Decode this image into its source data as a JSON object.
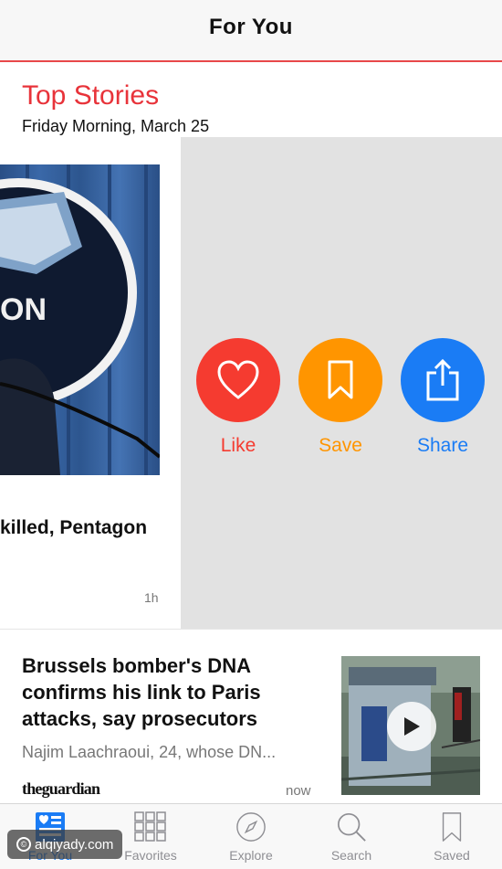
{
  "navbar": {
    "title": "For You"
  },
  "section": {
    "title": "Top Stories",
    "date": "Friday Morning, March 25"
  },
  "top_story": {
    "headline": "killed, Pentagon",
    "image_text": "ON",
    "time": "1h"
  },
  "actions": {
    "like": {
      "label": "Like",
      "color": "#f53b30"
    },
    "save": {
      "label": "Save",
      "color": "#ff9500"
    },
    "share": {
      "label": "Share",
      "color": "#1a7cf5"
    }
  },
  "article": {
    "title": "Brussels bomber's DNA confirms his link to Paris attacks, say prosecutors",
    "summary": "Najim Laachraoui, 24, whose DN...",
    "source": "theguardian",
    "time": "now"
  },
  "tabbar": {
    "tabs": [
      {
        "label": "For You",
        "icon": "for-you-icon",
        "active": true
      },
      {
        "label": "Favorites",
        "icon": "favorites-grid-icon",
        "active": false
      },
      {
        "label": "Explore",
        "icon": "compass-icon",
        "active": false
      },
      {
        "label": "Search",
        "icon": "search-icon",
        "active": false
      },
      {
        "label": "Saved",
        "icon": "bookmark-icon",
        "active": false
      }
    ]
  },
  "watermark": {
    "text": "alqiyady.com"
  },
  "colors": {
    "accent_red": "#e8333a",
    "tab_active": "#1a7cf5",
    "tray_bg": "#e2e2e2"
  }
}
